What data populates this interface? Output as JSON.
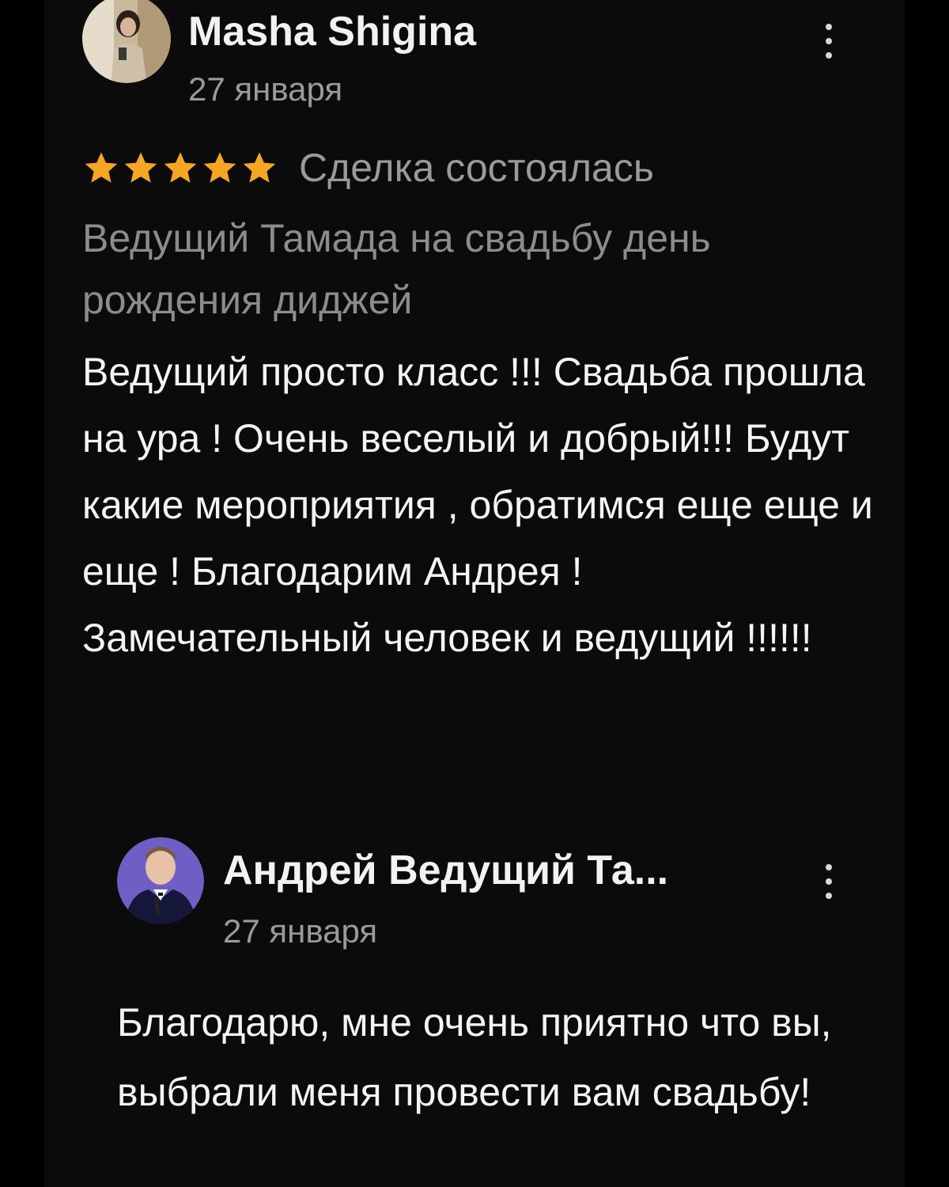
{
  "review": {
    "author": "Masha Shigina",
    "date": "27 января",
    "rating": 5,
    "rating_max": 5,
    "deal_status": "Сделка состоялась",
    "service_title": "Ведущий Тамада на свадьбу день рождения диджей",
    "text": "Ведущий просто класс !!! Свадьба прошла на ура ! Очень веселый и добрый!!! Будут какие мероприятия , обратимся еще еще и еще ! Благодарим Андрея ! Замечательный человек и ведущий !!!!!!"
  },
  "reply": {
    "author": "Андрей Ведущий Та...",
    "date": "27 января",
    "text": "Благодарю, мне очень приятно что вы, выбрали меня провести вам свадьбу!"
  },
  "icons": {
    "review_menu": "more-vertical-icon",
    "reply_menu": "more-vertical-icon",
    "star": "star-icon"
  },
  "colors": {
    "background": "#000000",
    "card": "#0b0b0b",
    "star": "#f5a623",
    "primary_text": "#f4f4f4",
    "secondary_text": "#9a9a9a",
    "reply_avatar_bg": "#6f5fc4"
  }
}
